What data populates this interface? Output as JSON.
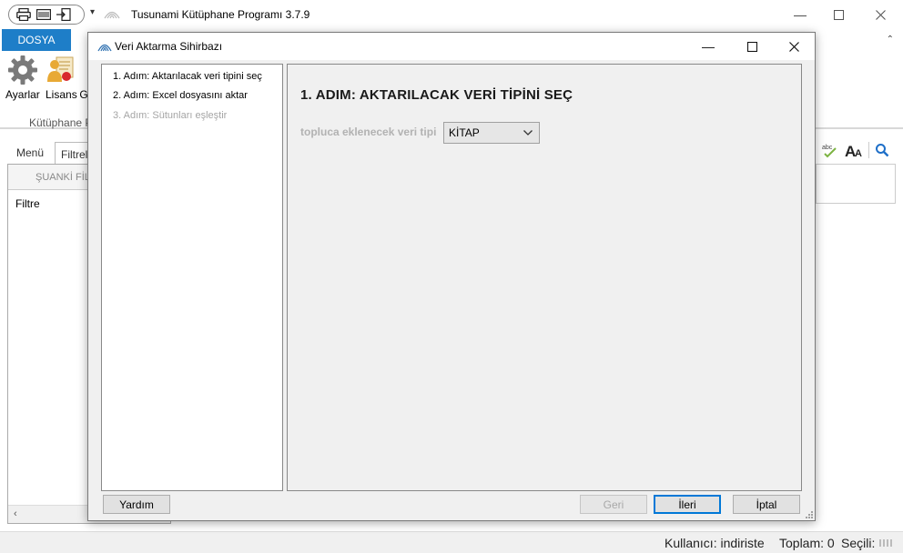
{
  "app": {
    "title": "Tusunami Kütüphane Programı 3.7.9",
    "file_tab": "DOSYA",
    "ribbon_buttons": [
      {
        "label": "Ayarlar",
        "icon": "gear-icon"
      },
      {
        "label": "Lisans",
        "icon": "license-icon"
      },
      {
        "label": "G",
        "icon": "partial-icon"
      }
    ],
    "ribbon_group_label": "Kütüphane P"
  },
  "left_panel": {
    "tabs": [
      "Menü",
      "Filtrel"
    ],
    "header": "ŞUANKİ FİL",
    "item": "Filtre"
  },
  "statusbar": {
    "user": "Kullanıcı: indiriste",
    "total": "Toplam: 0",
    "selected": "Seçili:"
  },
  "dialog": {
    "title": "Veri Aktarma Sihirbazı",
    "steps": [
      {
        "label": "1. Adım: Aktarılacak veri tipini seç",
        "enabled": true
      },
      {
        "label": "2. Adım: Excel dosyasını aktar",
        "enabled": true
      },
      {
        "label": "3. Adım: Sütunları eşleştir",
        "enabled": false
      }
    ],
    "content_title": "1. ADIM: AKTARILACAK VERİ TİPİNİ SEÇ",
    "field_label": "topluca eklenecek veri tipi",
    "select_value": "KİTAP",
    "buttons": {
      "help": "Yardım",
      "back": "Geri",
      "next": "İleri",
      "cancel": "İptal"
    }
  },
  "colors": {
    "accent": "#1e7ec8",
    "default_button_border": "#0078d7",
    "disabled_text": "#a5a5a5"
  }
}
